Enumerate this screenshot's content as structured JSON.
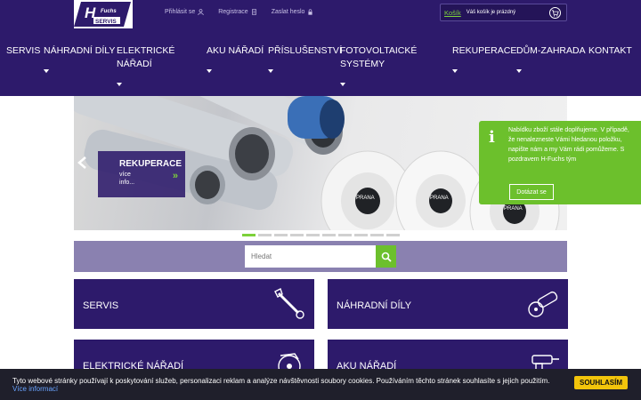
{
  "header": {
    "logo_text": "H Fuchs SERVIS",
    "links": {
      "login": "Přihlásit se",
      "register": "Registrace",
      "password": "Zaslat heslo"
    },
    "cart": {
      "link": "Košík",
      "status": "Váš košík je prázdný"
    }
  },
  "nav": {
    "items": [
      {
        "line1": "SERVIS",
        "line2": ""
      },
      {
        "line1": "NÁHRADNÍ DÍLY",
        "line2": ""
      },
      {
        "line1": "ELEKTRICKÉ",
        "line2": "NÁŘADÍ"
      },
      {
        "line1": "AKU NÁŘADÍ",
        "line2": ""
      },
      {
        "line1": "PŘÍSLUŠENSTVÍ",
        "line2": ""
      },
      {
        "line1": "FOTOVOLTAICKÉ",
        "line2": "SYSTÉMY"
      },
      {
        "line1": "REKUPERACE",
        "line2": ""
      },
      {
        "line1": "DŮM-ZAHRADA",
        "line2": ""
      },
      {
        "line1": "KONTAKT",
        "line2": ""
      }
    ]
  },
  "slider": {
    "caption_title": "REKUPERACE",
    "caption_more": "více info...",
    "unit_label": "PRANA",
    "dot_count": 10,
    "active_dot": 0
  },
  "notice": {
    "text": "Nabídku zboží stále doplňujeme. V případě, že nenalezneste Vámi hledanou položku, napište nám a my Vám rádi pomůžeme. S pozdravem H-Fuchs tým",
    "button": "Dotázat se"
  },
  "search": {
    "placeholder": "Hledat"
  },
  "tiles": [
    {
      "label": "SERVIS",
      "icon": "wrench-icon"
    },
    {
      "label": "NÁHRADNÍ DÍLY",
      "icon": "angle-grinder-icon"
    },
    {
      "label": "ELEKTRICKÉ NÁŘADÍ",
      "icon": "circular-saw-icon"
    },
    {
      "label": "AKU NÁŘADÍ",
      "icon": "cordless-drill-icon"
    }
  ],
  "cookie": {
    "text": "Tyto webové stránky používají k poskytování služeb, personalizaci reklam a analýze návštěvnosti soubory cookies. Používáním těchto stránek souhlasíte s jejich použitím.",
    "link": "Více informací",
    "button": "SOUHLASÍM"
  },
  "colors": {
    "primary": "#2d1a6b",
    "accent": "#6cc02c",
    "search_band": "#8a81b0",
    "cookie_bg": "#1f1f2b",
    "cookie_button": "#f2c40b"
  }
}
